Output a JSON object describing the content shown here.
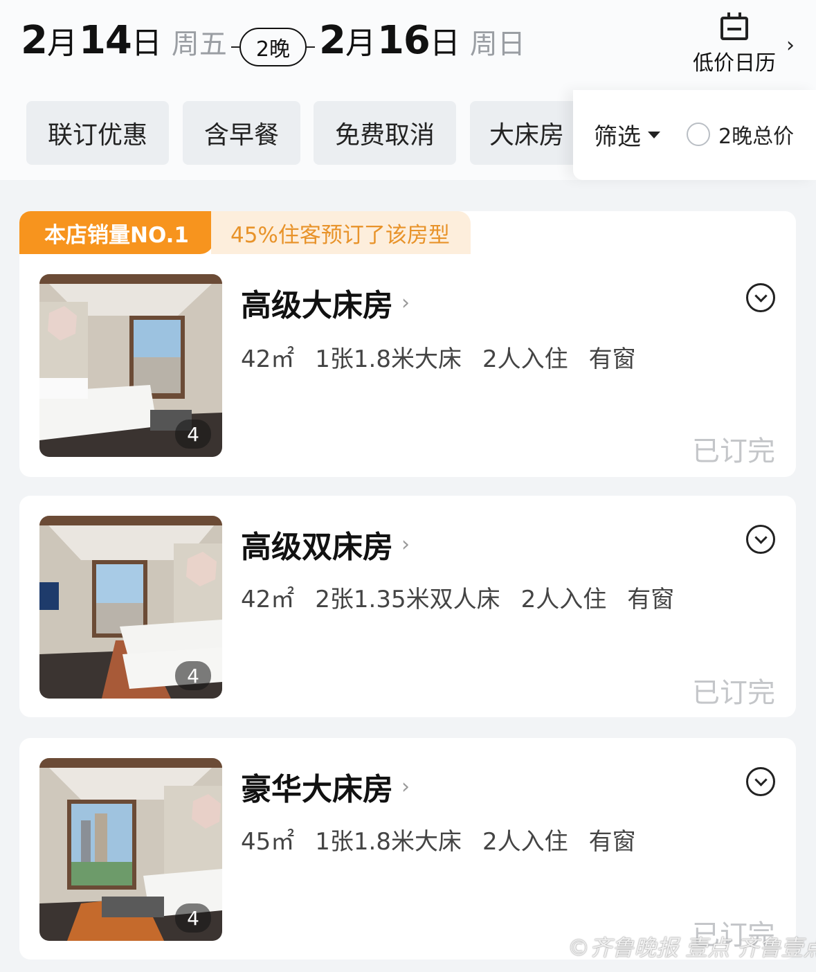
{
  "date_bar": {
    "checkin": {
      "month": "2",
      "month_unit": "月",
      "day": "14",
      "day_unit": "日",
      "weekday": "周五"
    },
    "nights": "2晚",
    "checkout": {
      "month": "2",
      "month_unit": "月",
      "day": "16",
      "day_unit": "日",
      "weekday": "周日"
    },
    "calendar_label": "低价日历",
    "calendar_icon": "calendar-icon",
    "chevron": "›"
  },
  "filters": {
    "chips": [
      "联订优惠",
      "含早餐",
      "免费取消",
      "大床房"
    ],
    "filter_label": "筛选",
    "total_price_label": "2晚总价"
  },
  "rooms": [
    {
      "badge": "本店销量NO.1",
      "badge_note": "45%住客预订了该房型",
      "name": "高级大床房",
      "chevron": "›",
      "area": "42㎡",
      "bed": "1张1.8米大床",
      "occupancy": "2人入住",
      "window": "有窗",
      "photo_count": "4",
      "status": "已订完"
    },
    {
      "name": "高级双床房",
      "chevron": "›",
      "area": "42㎡",
      "bed": "2张1.35米双人床",
      "occupancy": "2人入住",
      "window": "有窗",
      "photo_count": "4",
      "status": "已订完"
    },
    {
      "name": "豪华大床房",
      "chevron": "›",
      "area": "45㎡",
      "bed": "1张1.8米大床",
      "occupancy": "2人入住",
      "window": "有窗",
      "photo_count": "4",
      "status": "已订完"
    }
  ],
  "watermark": "©齐鲁晚报 壹点 齐鲁壹点",
  "colors": {
    "accent_orange": "#f7941e",
    "badge_bg": "#fdeedc",
    "sold_out": "#c4c6c9"
  }
}
